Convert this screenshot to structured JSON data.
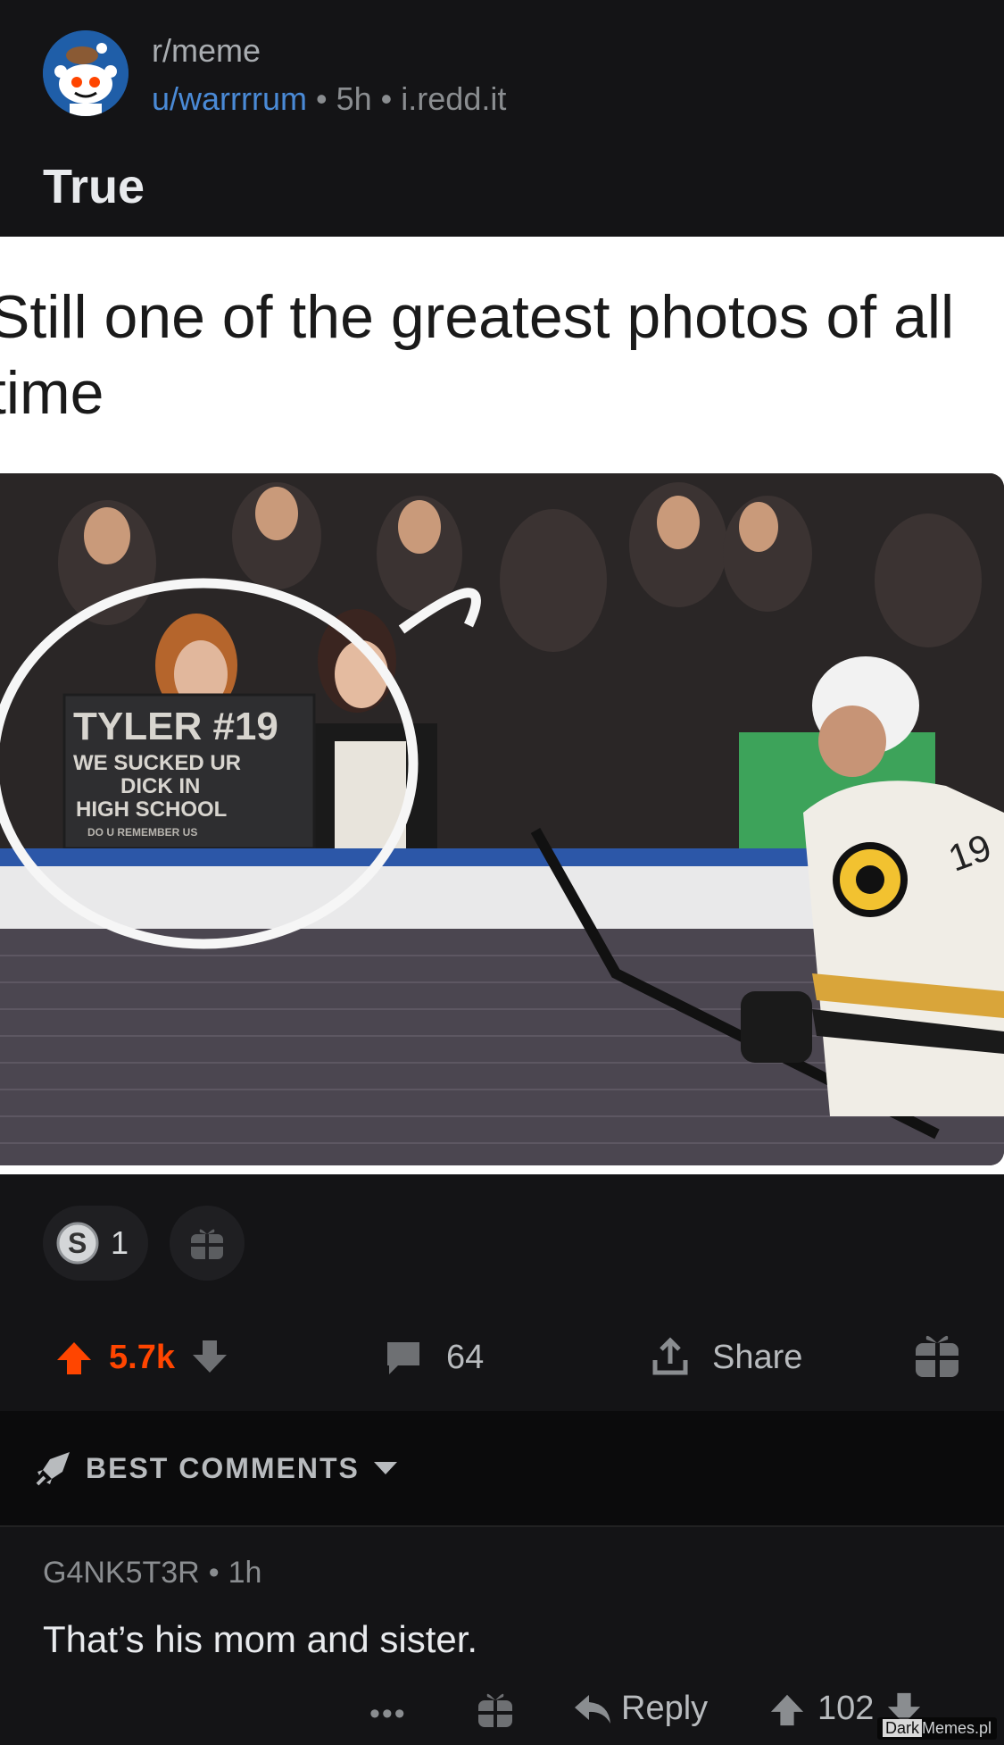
{
  "post": {
    "subreddit": "r/meme",
    "author": "u/warrrrum",
    "age": "5h",
    "domain": "i.redd.it",
    "title": "True"
  },
  "image": {
    "caption": "Still one of the greatest photos of all time",
    "sign_line1": "TYLER #19",
    "sign_line2": "WE SUCKED UR",
    "sign_line3": "DICK IN",
    "sign_line4": "HIGH SCHOOL",
    "sign_line5": "DO U REMEMBER US",
    "jersey_number": "19"
  },
  "awards": {
    "silver_count": "1"
  },
  "actions": {
    "score": "5.7k",
    "comments": "64",
    "share_label": "Share"
  },
  "comments_section": {
    "sort_label": "BEST COMMENTS",
    "comment": {
      "author": "G4NK5T3R",
      "age": "1h",
      "body": "That’s his mom and sister.",
      "more": "•••",
      "reply_label": "Reply",
      "score": "102"
    }
  },
  "watermark": {
    "part1": "Dark",
    "part2": "Memes.pl"
  },
  "colors": {
    "upvote": "#ff4500",
    "link": "#4a8ad6",
    "background": "#141416"
  }
}
